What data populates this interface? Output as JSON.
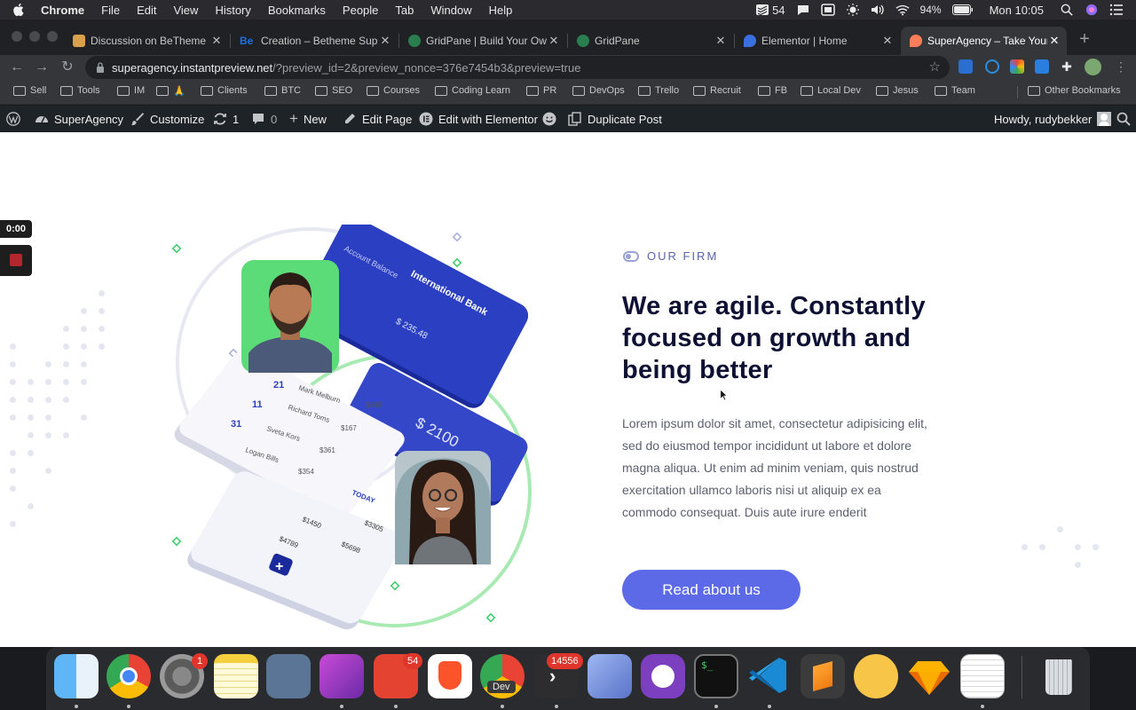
{
  "menubar": {
    "app_name": "Chrome",
    "items": [
      "File",
      "Edit",
      "View",
      "History",
      "Bookmarks",
      "People",
      "Tab",
      "Window",
      "Help"
    ],
    "todoist_count": "54",
    "battery": "94%",
    "clock": "Mon 10:05"
  },
  "tabs": [
    {
      "label": "Discussion on BeTheme -",
      "favicon_color": "#d8a04a"
    },
    {
      "label": "Creation – Betheme Suppo",
      "favicon_color": "#1b6fde",
      "favicon_text": "Be"
    },
    {
      "label": "GridPane | Build Your Own",
      "favicon_color": "#2a7d4f"
    },
    {
      "label": "GridPane",
      "favicon_color": "#2a7d4f"
    },
    {
      "label": "Elementor | Home",
      "favicon_color": "#3a6fe0"
    },
    {
      "label": "SuperAgency – Take Your",
      "favicon_color": "#ff7e5a",
      "active": true
    }
  ],
  "address": {
    "host": "superagency.instantpreview.net",
    "path": "/?preview_id=2&preview_nonce=376e7454b3&preview=true"
  },
  "bookmarks": [
    "Sell",
    "Tools",
    "IM",
    "🙏",
    "Clients",
    "BTC",
    "SEO",
    "Courses",
    "Coding Learn",
    "PR",
    "DevOps",
    "Trello",
    "Recruit",
    "FB",
    "Local Dev",
    "Jesus",
    "Team"
  ],
  "bookmarks_other": "Other Bookmarks",
  "wpbar": {
    "site": "SuperAgency",
    "customize": "Customize",
    "updates": "1",
    "comments": "0",
    "new": "New",
    "edit_page": "Edit Page",
    "elementor": "Edit with Elementor",
    "duplicate": "Duplicate Post",
    "howdy": "Howdy, rudybekker"
  },
  "recording": {
    "time": "0:00"
  },
  "section": {
    "eyebrow": "OUR FIRM",
    "heading": "We are agile. Constantly focused on growth and being better",
    "body": "Lorem ipsum dolor sit amet, consectetur adipisicing elit, sed do eiusmod tempor incididunt ut labore et dolore magna aliqua. Ut enim ad minim veniam, quis nostrud exercitation ullamco laboris nisi ut aliquip ex ea commodo consequat. Duis aute irure enderit",
    "cta": "Read about us"
  },
  "illustration": {
    "card1_title": "International Bank",
    "card1_label": "Account Balance",
    "card1_amount": "$ 235.48",
    "card2_amount": "$ 2100",
    "rows": [
      {
        "day": "21",
        "name": "Mark Melburn",
        "amount": "$369"
      },
      {
        "day": "11",
        "name": "Richard Toms",
        "amount": "$167"
      },
      {
        "day": "31",
        "name": "Sveta Kors",
        "amount": "$361"
      },
      {
        "day": "",
        "name": "Logan Bills",
        "amount": "$354"
      }
    ],
    "today_label": "TODAY",
    "stats": [
      "$1450",
      "$4789",
      "$3305",
      "$5698"
    ]
  },
  "dock": {
    "settings_badge": "1",
    "todoist_badge": "54",
    "dev_label": "Dev",
    "terminal_badge": "14556"
  },
  "colors": {
    "accent": "#5c6ae8",
    "heading": "#0e1133",
    "eyebrow": "#5a62a8",
    "wp_bar": "#1d2327"
  }
}
